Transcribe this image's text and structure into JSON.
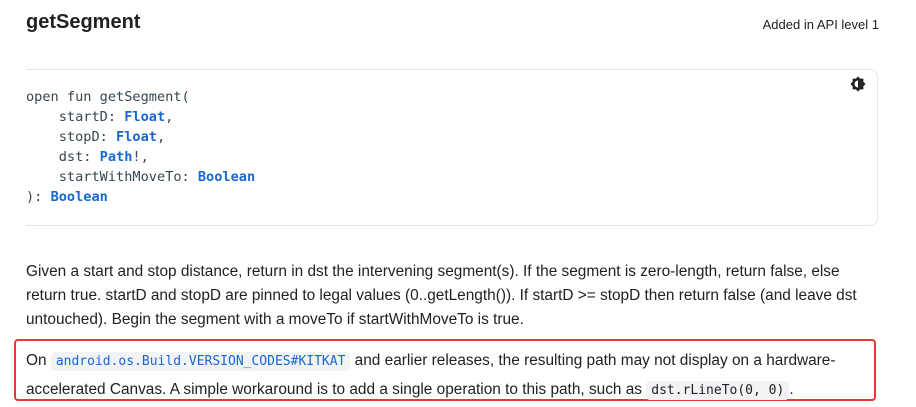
{
  "header": {
    "title": "getSegment",
    "api_level": "Added in API level 1"
  },
  "code": {
    "line1": "open fun getSegment(",
    "p1_name": "    startD: ",
    "p1_type": "Float",
    "p1_end": ",",
    "p2_name": "    stopD: ",
    "p2_type": "Float",
    "p2_end": ",",
    "p3_name": "    dst: ",
    "p3_type": "Path",
    "p3_end": "!,",
    "p4_name": "    startWithMoveTo: ",
    "p4_type": "Boolean",
    "close": "): ",
    "return_type": "Boolean",
    "toggle_icon": "brightness-icon"
  },
  "description": "Given a start and stop distance, return in dst the intervening segment(s). If the segment is zero-length, return false, else return true. startD and stopD are pinned to legal values (0..getLength()). If startD >= stopD then return false (and leave dst untouched). Begin the segment with a moveTo if startWithMoveTo is true.",
  "note": {
    "prefix": "On ",
    "link": "android.os.Build.VERSION_CODES#KITKAT",
    "middle": " and earlier releases, the resulting path may not display on a hardware-accelerated Canvas. A simple workaround is to add a single operation to this path, such as ",
    "code": "dst.rLineTo(0, 0)",
    "suffix": "."
  },
  "colors": {
    "highlight_border": "#e53935",
    "type_color": "#1967d2"
  }
}
